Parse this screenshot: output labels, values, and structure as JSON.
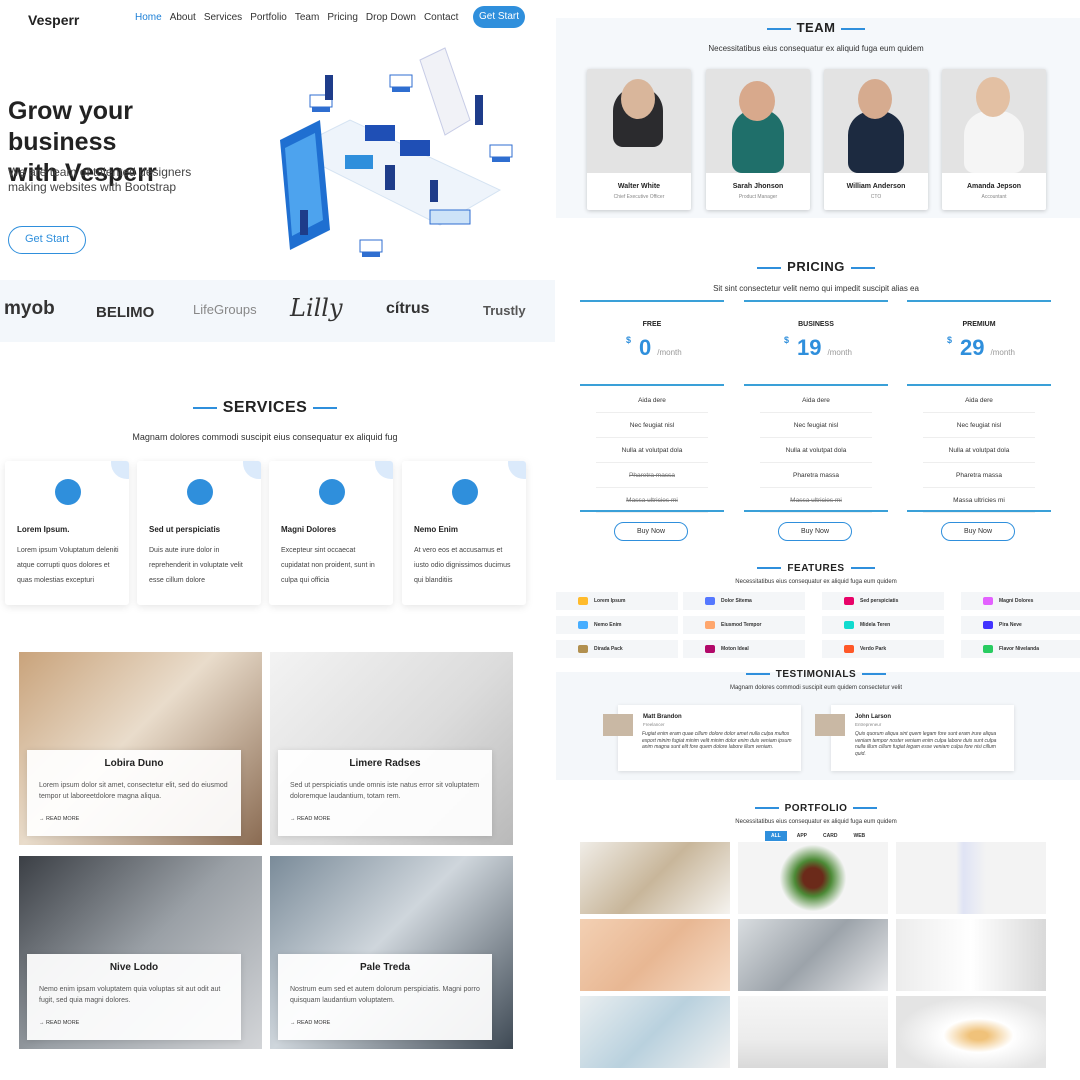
{
  "nav": {
    "logo": "Vesperr",
    "links": [
      "Home",
      "About",
      "Services",
      "Portfolio",
      "Team",
      "Pricing",
      "Drop Down",
      "Contact"
    ],
    "cta": "Get Start"
  },
  "hero": {
    "title_line1": "Grow your business",
    "title_line2": "with Vesperr",
    "subtitle": "We are team of talented designers making websites with Bootstrap",
    "button": "Get Start"
  },
  "clients": [
    "myob",
    "BELIMO",
    "LifeGroups",
    "Lilly",
    "cítrus",
    "Trustly"
  ],
  "services": {
    "title": "SERVICES",
    "subtitle": "Magnam dolores commodi suscipit eius consequatur ex aliquid fug",
    "items": [
      {
        "title": "Lorem Ipsum.",
        "desc": "Lorem ipsum Voluptatum deleniti atque corrupti quos dolores et quas molestias excepturi",
        "icon": "dribbble-icon"
      },
      {
        "title": "Sed ut perspiciatis",
        "desc": "Duis aute irure dolor in reprehenderit in voluptate velit esse cillum dolore",
        "icon": "file-icon"
      },
      {
        "title": "Magni Dolores",
        "desc": "Excepteur sint occaecat cupidatat non proident, sunt in culpa qui officia",
        "icon": "speedometer-icon"
      },
      {
        "title": "Nemo Enim",
        "desc": "At vero eos et accusamus et iusto odio dignissimos ducimus qui blanditiis",
        "icon": "globe-icon"
      }
    ]
  },
  "blog": [
    {
      "title": "Lobira Duno",
      "desc": "Lorem ipsum dolor sit amet, consectetur elit, sed do eiusmod tempor ut laboreetdolore magna aliqua.",
      "more": "→ READ MORE"
    },
    {
      "title": "Limere Radses",
      "desc": "Sed ut perspiciatis unde omnis iste natus error sit voluptatem doloremque laudantium, totam rem.",
      "more": "→ READ MORE"
    },
    {
      "title": "Nive Lodo",
      "desc": "Nemo enim ipsam voluptatem quia voluptas sit aut odit aut fugit, sed quia magni dolores.",
      "more": "→ READ MORE"
    },
    {
      "title": "Pale Treda",
      "desc": "Nostrum eum sed et autem dolorum perspiciatis. Magni porro quisquam laudantium voluptatem.",
      "more": "→ READ MORE"
    }
  ],
  "team": {
    "title": "TEAM",
    "subtitle": "Necessitatibus eius consequatur ex aliquid fuga eum quidem",
    "members": [
      {
        "name": "Walter White",
        "role": "Chief Executive Officer"
      },
      {
        "name": "Sarah Jhonson",
        "role": "Product Manager"
      },
      {
        "name": "William Anderson",
        "role": "CTO"
      },
      {
        "name": "Amanda Jepson",
        "role": "Accountant"
      }
    ]
  },
  "pricing": {
    "title": "PRICING",
    "subtitle": "Sit sint consectetur velit nemo qui impedit suscipit alias ea",
    "currency": "$",
    "period": "/month",
    "button": "Buy Now",
    "plans": [
      {
        "name": "FREE",
        "price": "0",
        "features": [
          "Aida dere",
          "Nec feugiat nisl",
          "Nulla at volutpat dola",
          "Pharetra massa",
          "Massa ultricies mi"
        ],
        "struck": [
          false,
          false,
          false,
          true,
          true
        ]
      },
      {
        "name": "BUSINESS",
        "price": "19",
        "features": [
          "Aida dere",
          "Nec feugiat nisl",
          "Nulla at volutpat dola",
          "Pharetra massa",
          "Massa ultricies mi"
        ],
        "struck": [
          false,
          false,
          false,
          false,
          true
        ]
      },
      {
        "name": "PREMIUM",
        "price": "29",
        "features": [
          "Aida dere",
          "Nec feugiat nisl",
          "Nulla at volutpat dola",
          "Pharetra massa",
          "Massa ultricies mi"
        ],
        "struck": [
          false,
          false,
          false,
          false,
          false
        ]
      }
    ]
  },
  "features": {
    "title": "FEATURES",
    "subtitle": "Necessitatibus eius consequatur ex aliquid fuga eum quidem",
    "items": [
      {
        "label": "Lorem Ipsum",
        "color": "#ffbb2c"
      },
      {
        "label": "Dolor Sitema",
        "color": "#5578ff"
      },
      {
        "label": "Sed perspiciatis",
        "color": "#e80368"
      },
      {
        "label": "Magni Dolores",
        "color": "#e361ff"
      },
      {
        "label": "Nemo Enim",
        "color": "#47aeff"
      },
      {
        "label": "Eiusmod Tempor",
        "color": "#ffa76e"
      },
      {
        "label": "Midela Teren",
        "color": "#11dbcf"
      },
      {
        "label": "Pira Neve",
        "color": "#4233ff"
      },
      {
        "label": "Dirada Pack",
        "color": "#b2904f"
      },
      {
        "label": "Moton Ideal",
        "color": "#b20969"
      },
      {
        "label": "Verdo Park",
        "color": "#ff5828"
      },
      {
        "label": "Flavor Nivelanda",
        "color": "#29cc61"
      }
    ]
  },
  "testimonials": {
    "title": "TESTIMONIALS",
    "subtitle": "Magnam dolores commodi suscipit eum quidem consectetur velit",
    "items": [
      {
        "name": "Matt Brandon",
        "role": "Freelancer",
        "quote": "Fugiat enim eram quae cillum dolore dolor amet nulla culpa multos export minim fugiat minim velit minim dolor enim duis veniam ipsum anim magna sunt elit fore quem dolore labore illum veniam."
      },
      {
        "name": "John Larson",
        "role": "Entrepreneur",
        "quote": "Quis quorum aliqua sint quem legam fore sunt eram irure aliqua veniam tempor noster veniam enim culpa labore duis sunt culpa nulla illum cillum fugiat legam esse veniam culpa fore nisi cillum quid."
      }
    ]
  },
  "portfolio": {
    "title": "PORTFOLIO",
    "subtitle": "Necessitatibus eius consequatur ex aliquid fuga eum quidem",
    "filters": [
      "ALL",
      "APP",
      "CARD",
      "WEB"
    ]
  }
}
